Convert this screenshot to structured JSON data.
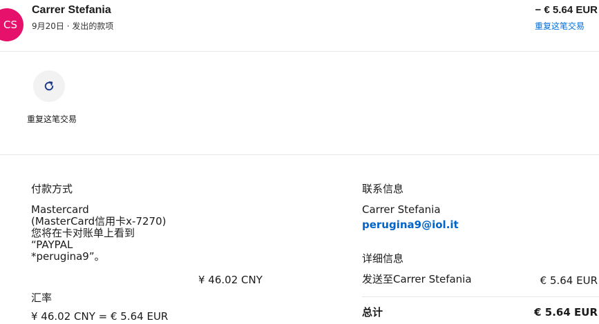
{
  "header": {
    "avatar_initials": "CS",
    "name": "Carrer Stefania",
    "subtitle": "9月20日 · 发出的款项",
    "amount": "− € 5.64 EUR",
    "repeat_link": "重复这笔交易"
  },
  "actions": {
    "repeat_label": "重复这笔交易",
    "repeat_icon": "refresh-icon"
  },
  "payment": {
    "heading": "付款方式",
    "lines": [
      "Mastercard",
      "(MasterCard信用卡x-7270)",
      "您将在卡对账单上看到",
      "“PAYPAL",
      "*perugina9”。"
    ],
    "amount": "¥ 46.02 CNY",
    "exchange_heading": "汇率",
    "exchange_value": "¥ 46.02 CNY = € 5.64 EUR"
  },
  "contact": {
    "heading": "联系信息",
    "name": "Carrer Stefania",
    "email": "perugina9@iol.it"
  },
  "details": {
    "heading": "详细信息",
    "sent_to_label": "发送至Carrer Stefania",
    "sent_to_amount": "€ 5.64 EUR",
    "total_label": "总计",
    "total_amount": "€ 5.64 EUR"
  },
  "colors": {
    "avatar": "#e5116b",
    "link": "#0070e0"
  }
}
